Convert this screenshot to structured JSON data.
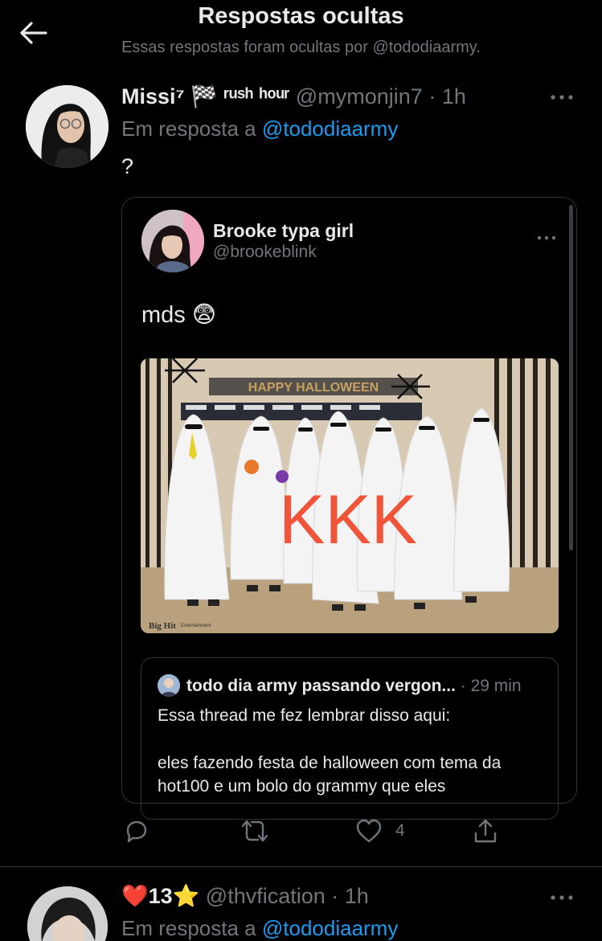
{
  "header": {
    "title": "Respostas ocultas",
    "subtitle": "Essas respostas foram ocultas por @tododiaarmy."
  },
  "tweet1": {
    "display_name": "Missi⁷ 🏁 ʳᵘˢʰ ʰᵒᵘʳ",
    "handle": "@mymonjin7",
    "time": "· 1h",
    "reply_prefix": "Em resposta a",
    "reply_to": "@tododiaarmy",
    "text": "?",
    "quoted": {
      "display_name": "Brooke typa girl",
      "handle": "@brookeblink",
      "text": "mds 😨",
      "media": {
        "banner_text": "HAPPY HALLOWEEN",
        "overlay_text": "KKK",
        "watermark": "Big Hit",
        "watermark_small": "Entertainment"
      },
      "inner_quote": {
        "display_name": "todo dia army passando vergon...",
        "time": "· 29 min",
        "line1": "Essa thread me fez lembrar disso aqui:",
        "line2": "eles fazendo festa de halloween com tema da",
        "line3": "hot100 e um bolo do grammy que eles"
      }
    },
    "actions": {
      "reply_count": "",
      "retweet_count": "",
      "like_count": "4"
    }
  },
  "tweet2": {
    "display_name": "❤️13⭐",
    "handle": "@thvfication",
    "time": "· 1h",
    "reply_prefix": "Em resposta a",
    "reply_to": "@tododiaarmy"
  },
  "icons": {
    "back": "back-arrow-icon",
    "more": "more-dots-icon",
    "reply": "reply-icon",
    "retweet": "retweet-icon",
    "like": "heart-icon",
    "share": "share-icon"
  },
  "colors": {
    "background": "#000000",
    "text": "#e7e9ea",
    "muted": "#71767b",
    "link": "#1d9bf0",
    "border": "#2f3336",
    "overlay_text": "#f0553a"
  }
}
